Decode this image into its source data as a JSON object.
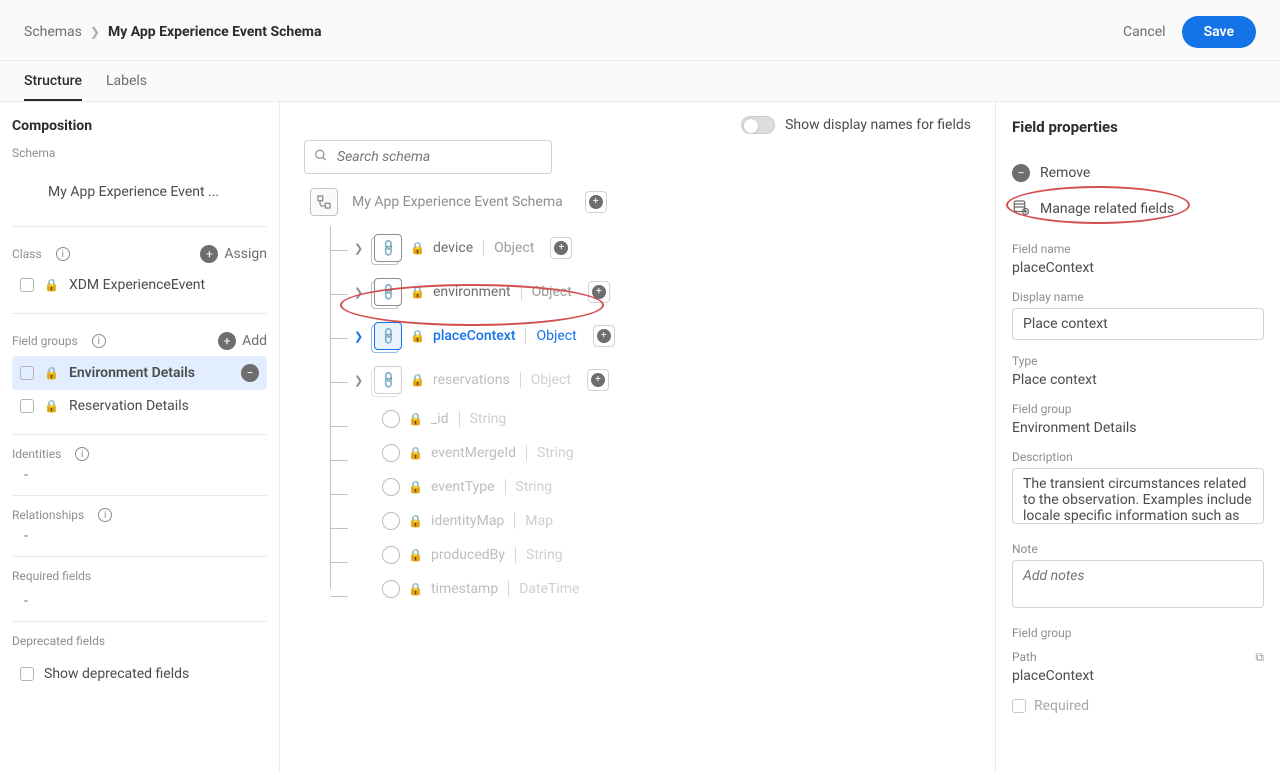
{
  "header": {
    "breadcrumb_parent": "Schemas",
    "breadcrumb_current": "My App Experience Event Schema",
    "cancel": "Cancel",
    "save": "Save"
  },
  "tabs": {
    "structure": "Structure",
    "labels": "Labels"
  },
  "left": {
    "composition": "Composition",
    "schema_label": "Schema",
    "schema_name": "My App Experience Event ...",
    "class_label": "Class",
    "assign": "Assign",
    "class_name": "XDM ExperienceEvent",
    "field_groups_label": "Field groups",
    "add": "Add",
    "env_details": "Environment Details",
    "res_details": "Reservation Details",
    "identities": "Identities",
    "relationships": "Relationships",
    "required": "Required fields",
    "deprecated": "Deprecated fields",
    "show_deprecated": "Show deprecated fields",
    "dash": "-"
  },
  "canvas": {
    "toggle_label": "Show display names for fields",
    "search_placeholder": "Search schema",
    "root": "My App Experience Event Schema",
    "nodes": {
      "device": {
        "name": "device",
        "type": "Object"
      },
      "environment": {
        "name": "environment",
        "type": "Object"
      },
      "placeContext": {
        "name": "placeContext",
        "type": "Object"
      },
      "reservations": {
        "name": "reservations",
        "type": "Object"
      },
      "id": {
        "name": "_id",
        "type": "String"
      },
      "eventMergeId": {
        "name": "eventMergeId",
        "type": "String"
      },
      "eventType": {
        "name": "eventType",
        "type": "String"
      },
      "identityMap": {
        "name": "identityMap",
        "type": "Map"
      },
      "producedBy": {
        "name": "producedBy",
        "type": "String"
      },
      "timestamp": {
        "name": "timestamp",
        "type": "DateTime"
      }
    }
  },
  "right": {
    "title": "Field properties",
    "remove": "Remove",
    "manage": "Manage related fields",
    "field_name_label": "Field name",
    "field_name": "placeContext",
    "display_name_label": "Display name",
    "display_name": "Place context",
    "type_label": "Type",
    "type_value": "Place context",
    "field_group_label": "Field group",
    "field_group": "Environment Details",
    "description_label": "Description",
    "description": "The transient circumstances related to the observation. Examples include locale specific information such as",
    "note_label": "Note",
    "note_placeholder": "Add notes",
    "field_group2_label": "Field group",
    "path_label": "Path",
    "path": "placeContext",
    "required": "Required"
  }
}
